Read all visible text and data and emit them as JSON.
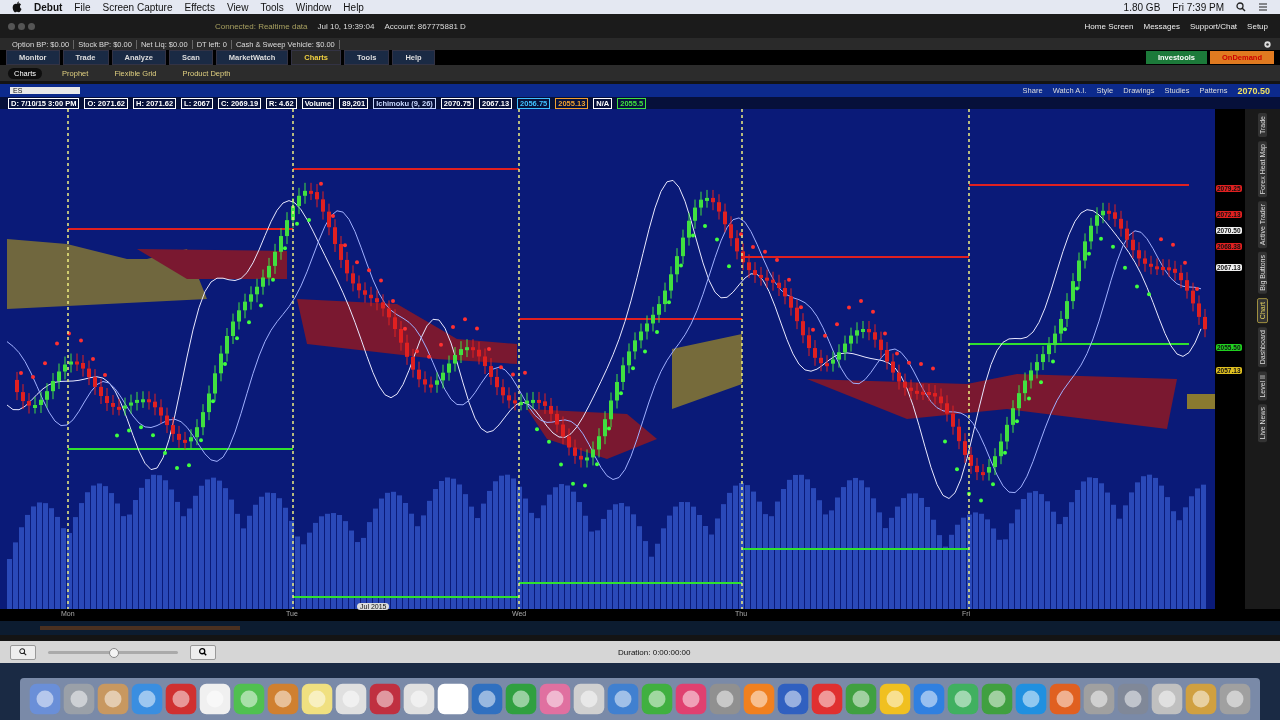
{
  "menu_bar": {
    "app": "Debut",
    "items": [
      "File",
      "Screen Capture",
      "Effects",
      "View",
      "Tools",
      "Window",
      "Help"
    ],
    "memory": "1.80 GB",
    "clock": "Fri 7:39 PM"
  },
  "status": {
    "connection": "Connected: Realtime data",
    "time": "Jul 10, 19:39:04",
    "account": "Account: 867775881 D",
    "links": [
      "Home Screen",
      "Messages",
      "Support/Chat",
      "Setup"
    ]
  },
  "balances": [
    "Option BP: $0.00",
    "Stock BP: $0.00",
    "Net Liq: $0.00",
    "DT left: 0",
    "Cash & Sweep Vehicle: $0.00"
  ],
  "tabs": [
    {
      "label": "Monitor",
      "selected": false
    },
    {
      "label": "Trade",
      "selected": false
    },
    {
      "label": "Analyze",
      "selected": false
    },
    {
      "label": "Scan",
      "selected": false
    },
    {
      "label": "MarketWatch",
      "selected": false
    },
    {
      "label": "Charts",
      "selected": true
    },
    {
      "label": "Tools",
      "selected": false
    },
    {
      "label": "Help",
      "selected": false
    }
  ],
  "promo_buttons": [
    "Investools",
    "OnDemand"
  ],
  "subtabs": [
    {
      "label": "Charts",
      "selected": true
    },
    {
      "label": "Prophet",
      "selected": false
    },
    {
      "label": "Flexible Grid",
      "selected": false
    },
    {
      "label": "Product Depth",
      "selected": false
    }
  ],
  "chart": {
    "symbol": "ES",
    "toolbar": [
      "Share",
      "Watch A.I.",
      "Style",
      "Drawings",
      "Studies",
      "Patterns"
    ],
    "last_price": "2070.50",
    "info": [
      {
        "text": "D: 7/10/15 3:00 PM",
        "color": "#ffffff"
      },
      {
        "text": "O: 2071.62",
        "color": "#ffffff"
      },
      {
        "text": "H: 2071.62",
        "color": "#ffffff"
      },
      {
        "text": "L: 2067",
        "color": "#ffffff"
      },
      {
        "text": "C: 2069.19",
        "color": "#ffffff"
      },
      {
        "text": "R: 4.62",
        "color": "#ffffff"
      },
      {
        "text": "Volume",
        "color": "#ffffff"
      },
      {
        "text": "89,201",
        "color": "#ffffff"
      },
      {
        "text": "Ichimoku (9, 26)",
        "color": "#c8d8ff"
      },
      {
        "text": "2070.75",
        "color": "#ffffff"
      },
      {
        "text": "2067.13",
        "color": "#ffffff"
      },
      {
        "text": "2056.75",
        "color": "#40c0ff"
      },
      {
        "text": "2055.13",
        "color": "#f0a030"
      },
      {
        "text": "N/A",
        "color": "#ffffff"
      },
      {
        "text": "2055.5",
        "color": "#40e040"
      }
    ],
    "price_tags": [
      {
        "text": "2079.25",
        "color": "#e02020"
      },
      {
        "text": "2072.13",
        "color": "#e02020"
      },
      {
        "text": "2070.50",
        "color": "#f0f0f0"
      },
      {
        "text": "2068.38",
        "color": "#e02020"
      },
      {
        "text": "2067.13",
        "color": "#f0f0f0"
      },
      {
        "text": "2055.50",
        "color": "#20d020"
      },
      {
        "text": "2057.13",
        "color": "#e0c020"
      }
    ],
    "time_labels": [
      "Mon",
      "Tue",
      "Wed",
      "Thu",
      "Fri"
    ],
    "date_marker": "Jul 2015"
  },
  "side_tabs": [
    {
      "label": "Trade",
      "selected": false
    },
    {
      "label": "Forex Heat Map",
      "selected": false
    },
    {
      "label": "Active Trader",
      "selected": false
    },
    {
      "label": "Big Buttons",
      "selected": false
    },
    {
      "label": "Chart",
      "selected": true
    },
    {
      "label": "Dashboard",
      "selected": false
    },
    {
      "label": "Level II",
      "selected": false
    },
    {
      "label": "Live News",
      "selected": false
    }
  ],
  "player": {
    "level": 0.5,
    "duration": "Duration: 0:00:00:00"
  }
}
